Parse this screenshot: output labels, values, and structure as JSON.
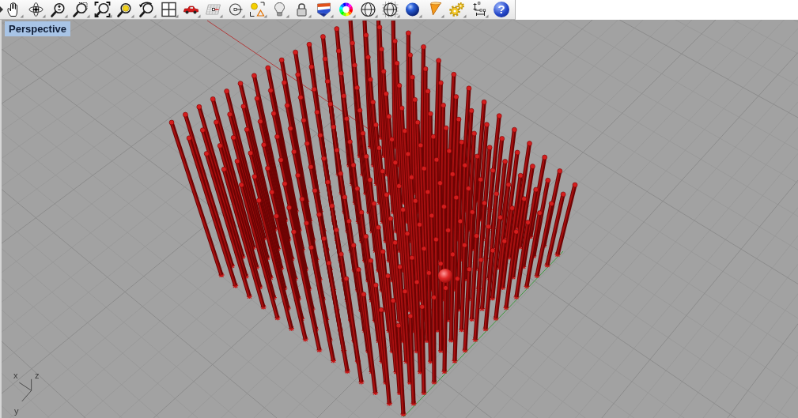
{
  "toolbar": {
    "help_label": "?"
  },
  "viewport": {
    "title": "Perspective"
  },
  "axis_widget": {
    "x_label": "x",
    "z_label": "z",
    "y_label": "y"
  }
}
